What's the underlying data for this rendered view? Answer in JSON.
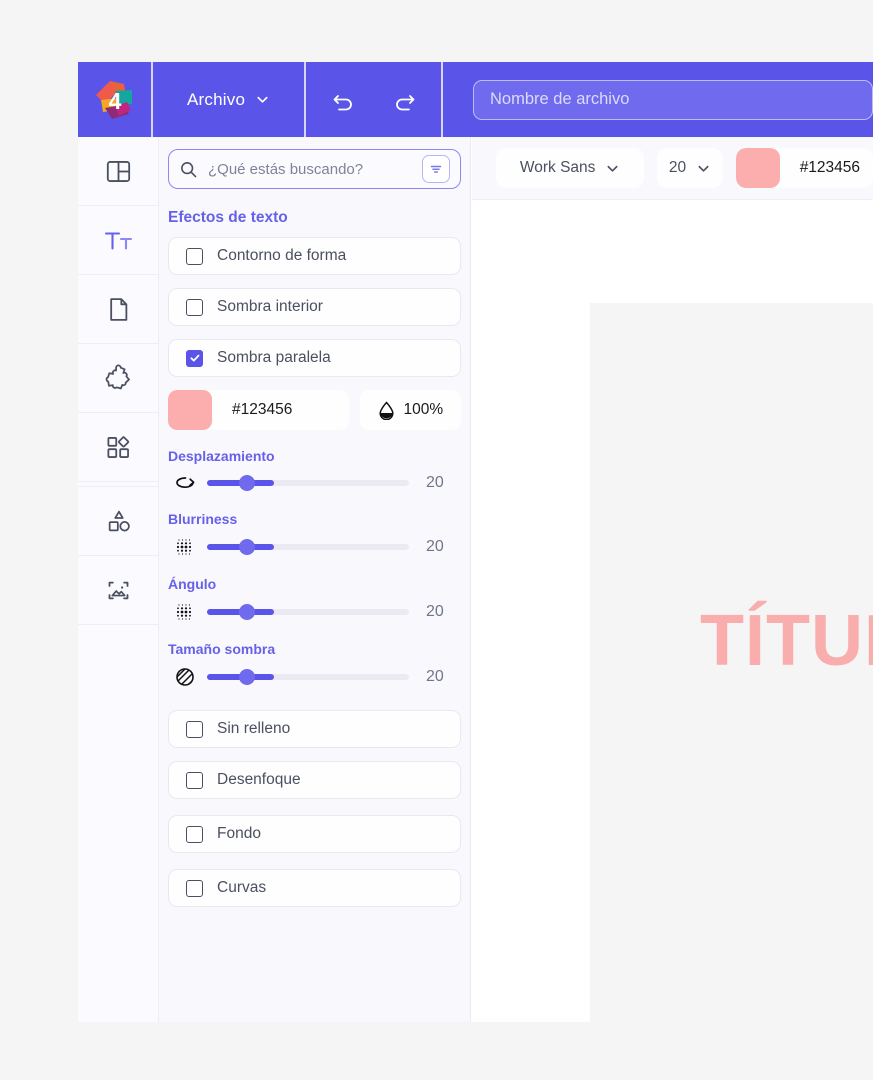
{
  "topbar": {
    "logo_alt": "app-logo-4",
    "menu_label": "Archivo",
    "undo_icon": "undo-icon",
    "redo_icon": "redo-icon",
    "filename_placeholder": "Nombre de archivo",
    "filename_value": "",
    "bar_color": "#5a55e8"
  },
  "rail": {
    "items": [
      {
        "icon": "layout-template-icon",
        "name": "templates",
        "active": false
      },
      {
        "icon": "text-tt-icon",
        "name": "text",
        "active": true
      },
      {
        "icon": "document-page-icon",
        "name": "pages",
        "active": false
      },
      {
        "icon": "puzzle-piece-icon",
        "name": "elements",
        "active": false
      },
      {
        "icon": "apps-grid-icon",
        "name": "apps",
        "active": false
      },
      {
        "icon": "shapes-icon",
        "name": "shapes",
        "active": false
      },
      {
        "icon": "image-placeholder-icon",
        "name": "images",
        "active": false
      }
    ]
  },
  "search": {
    "placeholder": "¿Qué estás buscando?",
    "value": "",
    "search_icon": "search-icon",
    "filter_icon": "filter-icon"
  },
  "panel": {
    "section_title": "Efectos de texto",
    "effects": [
      {
        "label": "Contorno de forma",
        "checked": false
      },
      {
        "label": "Sombra interior",
        "checked": false
      },
      {
        "label": "Sombra paralela",
        "checked": true
      }
    ],
    "shadow_color": {
      "hex_label": "#123456",
      "swatch_color": "#fcaeae",
      "opacity_label": "100%",
      "opacity_icon": "droplet-icon"
    },
    "sliders": [
      {
        "label": "Desplazamiento",
        "value": "20",
        "percent": 33,
        "thumb_percent": 20,
        "icon": "rotate-offset-icon"
      },
      {
        "label": "Blurriness",
        "value": "20",
        "percent": 33,
        "thumb_percent": 20,
        "icon": "dot-grid-blur-icon"
      },
      {
        "label": "Ángulo",
        "value": "20",
        "percent": 33,
        "thumb_percent": 20,
        "icon": "dot-grid-angle-icon"
      },
      {
        "label": "Tamaño sombra",
        "value": "20",
        "percent": 33,
        "thumb_percent": 20,
        "icon": "hatched-circle-icon"
      }
    ],
    "more_options": [
      {
        "label": "Sin relleno",
        "checked": false
      },
      {
        "label": "Desenfoque",
        "checked": false
      },
      {
        "label": "Fondo",
        "checked": false
      },
      {
        "label": "Curvas",
        "checked": false
      }
    ]
  },
  "toolbar": {
    "font_family": "Work Sans",
    "font_size": "20",
    "text_color_hex": "#123456",
    "text_color_swatch": "#fcaeae",
    "chevron_icon": "chevron-down-icon"
  },
  "canvas": {
    "title_text": "TÍTULO",
    "title_color": "#f9adad"
  }
}
